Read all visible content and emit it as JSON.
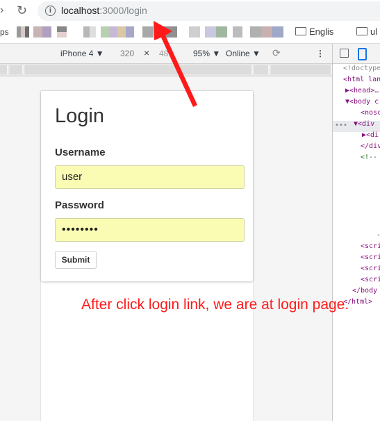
{
  "browser": {
    "url_host": "localhost",
    "url_rest": ":3000/login",
    "bookmarks_apps": "ps",
    "bookmark_folder_1": "Englis",
    "bookmark_folder_2": "ul"
  },
  "device_toolbar": {
    "device": "iPhone 4 ▼",
    "width": "320",
    "times": "×",
    "height": "48",
    "zoom": "95% ▼",
    "network": "Online ▼"
  },
  "page": {
    "title": "Login",
    "username_label": "Username",
    "username_value": "user",
    "password_label": "Password",
    "password_value": "••••••••",
    "submit_label": "Submit"
  },
  "devtools": {
    "lines": [
      {
        "text": "<!doctype",
        "cls": "t-gray",
        "indent": 15
      },
      {
        "text": "<html lan",
        "cls": "t-tag",
        "indent": 15
      },
      {
        "text": "▶<head>…",
        "cls": "t-tag",
        "indent": 18
      },
      {
        "text": "▼<body c",
        "cls": "t-tag",
        "indent": 18
      },
      {
        "text": "<nosc",
        "cls": "t-tag",
        "indent": 40
      },
      {
        "text": "▼<div",
        "cls": "t-tag",
        "indent": 30
      },
      {
        "text": "▶<di",
        "cls": "t-tag",
        "indent": 42
      },
      {
        "text": "</div",
        "cls": "t-tag",
        "indent": 40
      },
      {
        "text": "<!--",
        "cls": "t-comment",
        "indent": 40
      },
      {
        "text": "-",
        "cls": "t-comment",
        "indent": 63
      },
      {
        "text": "<scri",
        "cls": "t-tag",
        "indent": 40
      },
      {
        "text": "<scri",
        "cls": "t-tag",
        "indent": 40
      },
      {
        "text": "<scri",
        "cls": "t-tag",
        "indent": 40
      },
      {
        "text": "<scri",
        "cls": "t-tag",
        "indent": 40
      },
      {
        "text": "</body",
        "cls": "t-tag",
        "indent": 28
      },
      {
        "text": "</html>",
        "cls": "t-tag",
        "indent": 15
      }
    ]
  },
  "annotation": {
    "text": "After click login link, we are at login page.",
    "color": "#ff1a1a"
  },
  "colors": {
    "autofill": "#fafcb4",
    "accent_blue": "#1a73e8"
  }
}
